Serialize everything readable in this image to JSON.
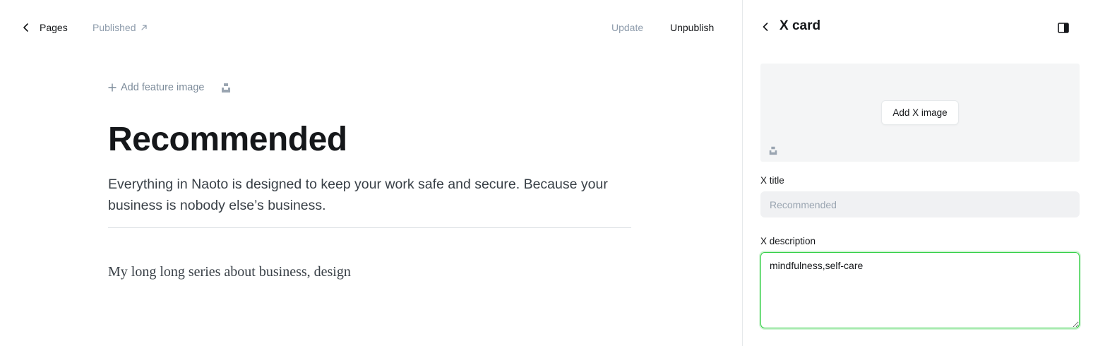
{
  "colors": {
    "text": "#15171a",
    "muted": "#8e9cac",
    "focus_border": "#30cf43",
    "input_bg": "#f0f1f3",
    "drop_bg": "#f4f5f6"
  },
  "editor": {
    "topbar": {
      "back_label": "Pages",
      "status_label": "Published",
      "update_label": "Update",
      "unpublish_label": "Unpublish"
    },
    "add_feature_image": "Add feature image",
    "title": "Recommended",
    "excerpt": "Everything in Naoto is designed to keep your work safe and secure. Because your business is nobody else’s business.",
    "body": "My long long series about business, design"
  },
  "panel": {
    "title": "X card",
    "add_image_label": "Add X image",
    "x_title_label": "X title",
    "x_title_placeholder": "Recommended",
    "x_description_label": "X description",
    "x_description_value": "mindfulness,self-care"
  },
  "icons": {
    "back": "chevron-left-icon",
    "external": "arrow-up-right-icon",
    "unsplash": "unsplash-icon",
    "sidebar_toggle": "sidebar-toggle-icon",
    "plus": "plus-icon"
  }
}
